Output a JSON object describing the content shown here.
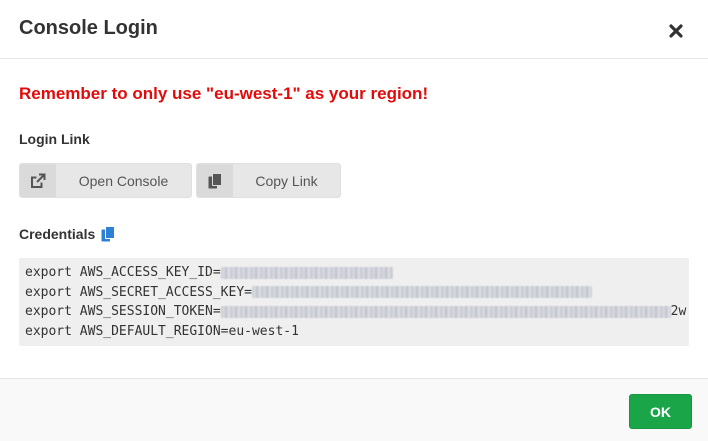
{
  "dialog": {
    "title": "Console Login",
    "close_icon": "close-icon"
  },
  "warning": {
    "text": "Remember to only use \"eu-west-1\" as your region!",
    "color": "#e00b0b"
  },
  "login_link": {
    "label": "Login Link",
    "open_console_label": "Open Console",
    "open_console_icon": "external-link-icon",
    "copy_link_label": "Copy Link",
    "copy_link_icon": "copy-icon"
  },
  "credentials": {
    "label": "Credentials",
    "copy_icon": "copy-icon",
    "lines": [
      {
        "prefix": "export AWS_ACCESS_KEY_ID=",
        "redacted": true
      },
      {
        "prefix": "export AWS_SECRET_ACCESS_KEY=",
        "redacted": true
      },
      {
        "prefix": "export AWS_SESSION_TOKEN=",
        "redacted": true,
        "trailing": "2w"
      },
      {
        "prefix": "export AWS_DEFAULT_REGION=eu-west-1",
        "redacted": false
      }
    ]
  },
  "footer": {
    "ok_label": "OK",
    "ok_color": "#1aa548"
  }
}
